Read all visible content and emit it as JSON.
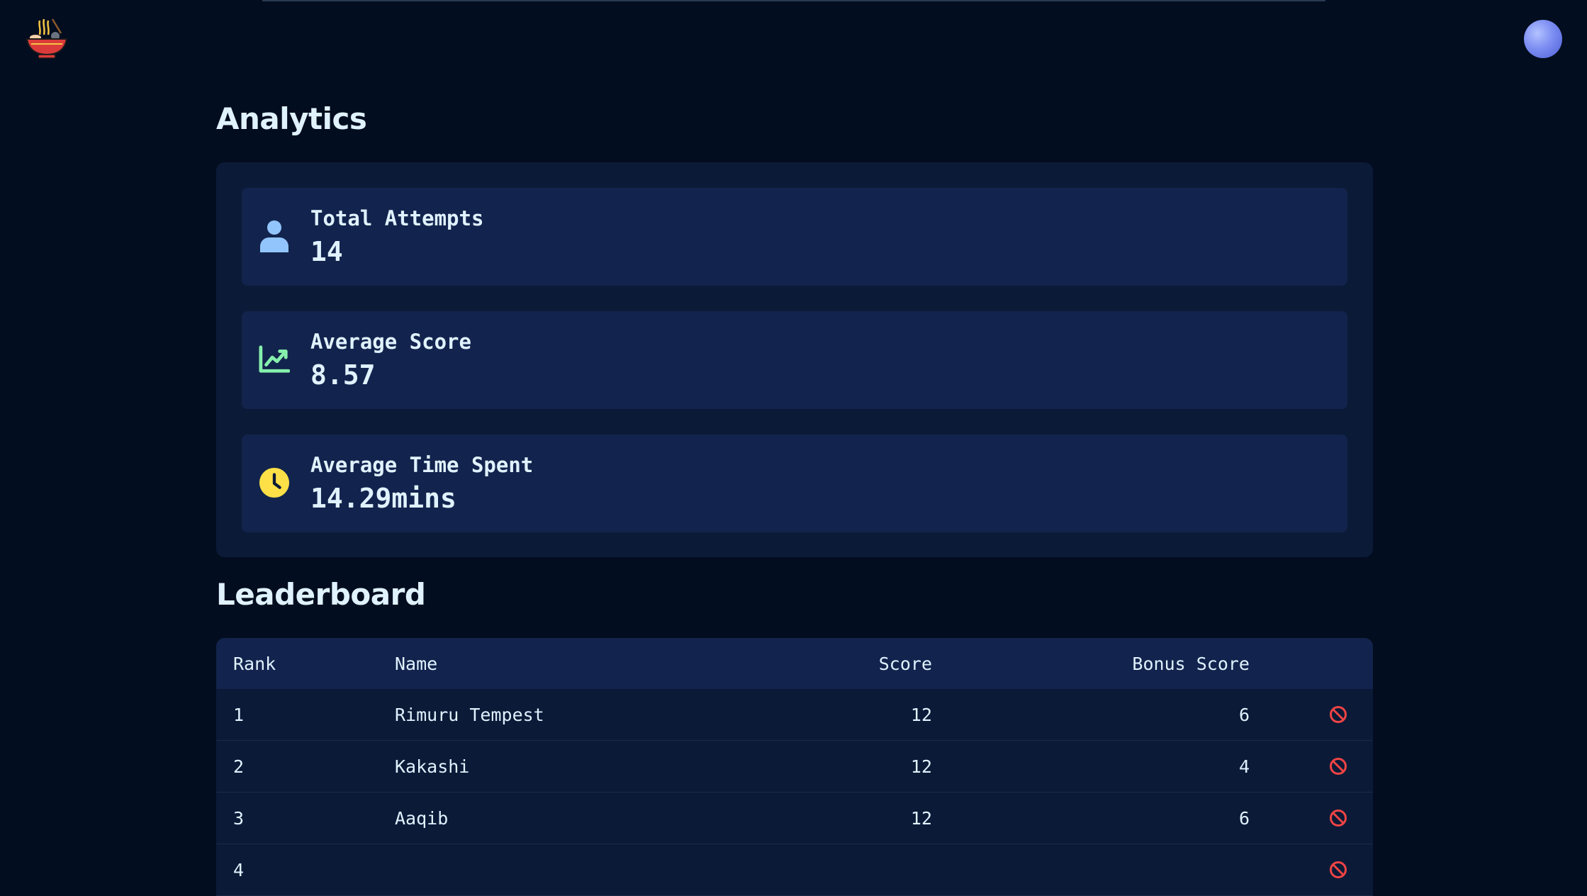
{
  "header": {
    "logo_icon": "ramen-bowl-icon",
    "avatar_icon": "user-avatar-icon"
  },
  "analytics": {
    "title": "Analytics",
    "stats": [
      {
        "label": "Total Attempts",
        "value": "14",
        "icon": "user-icon",
        "color": "#93c5fd"
      },
      {
        "label": "Average Score",
        "value": "8.57",
        "icon": "trending-up-chart-icon",
        "color": "#86efac"
      },
      {
        "label": "Average Time Spent",
        "value": "14.29mins",
        "icon": "clock-icon",
        "color": "#fde047"
      }
    ]
  },
  "leaderboard": {
    "title": "Leaderboard",
    "columns": [
      "Rank",
      "Name",
      "Score",
      "Bonus Score"
    ],
    "rows": [
      {
        "rank": "1",
        "name": "Rimuru Tempest",
        "score": "12",
        "bonus": "6"
      },
      {
        "rank": "2",
        "name": "Kakashi",
        "score": "12",
        "bonus": "4"
      },
      {
        "rank": "3",
        "name": "Aaqib",
        "score": "12",
        "bonus": "6"
      },
      {
        "rank": "4",
        "name": "",
        "score": "",
        "bonus": ""
      }
    ],
    "action_icon": "ban-icon",
    "action_color": "#ef4444"
  }
}
